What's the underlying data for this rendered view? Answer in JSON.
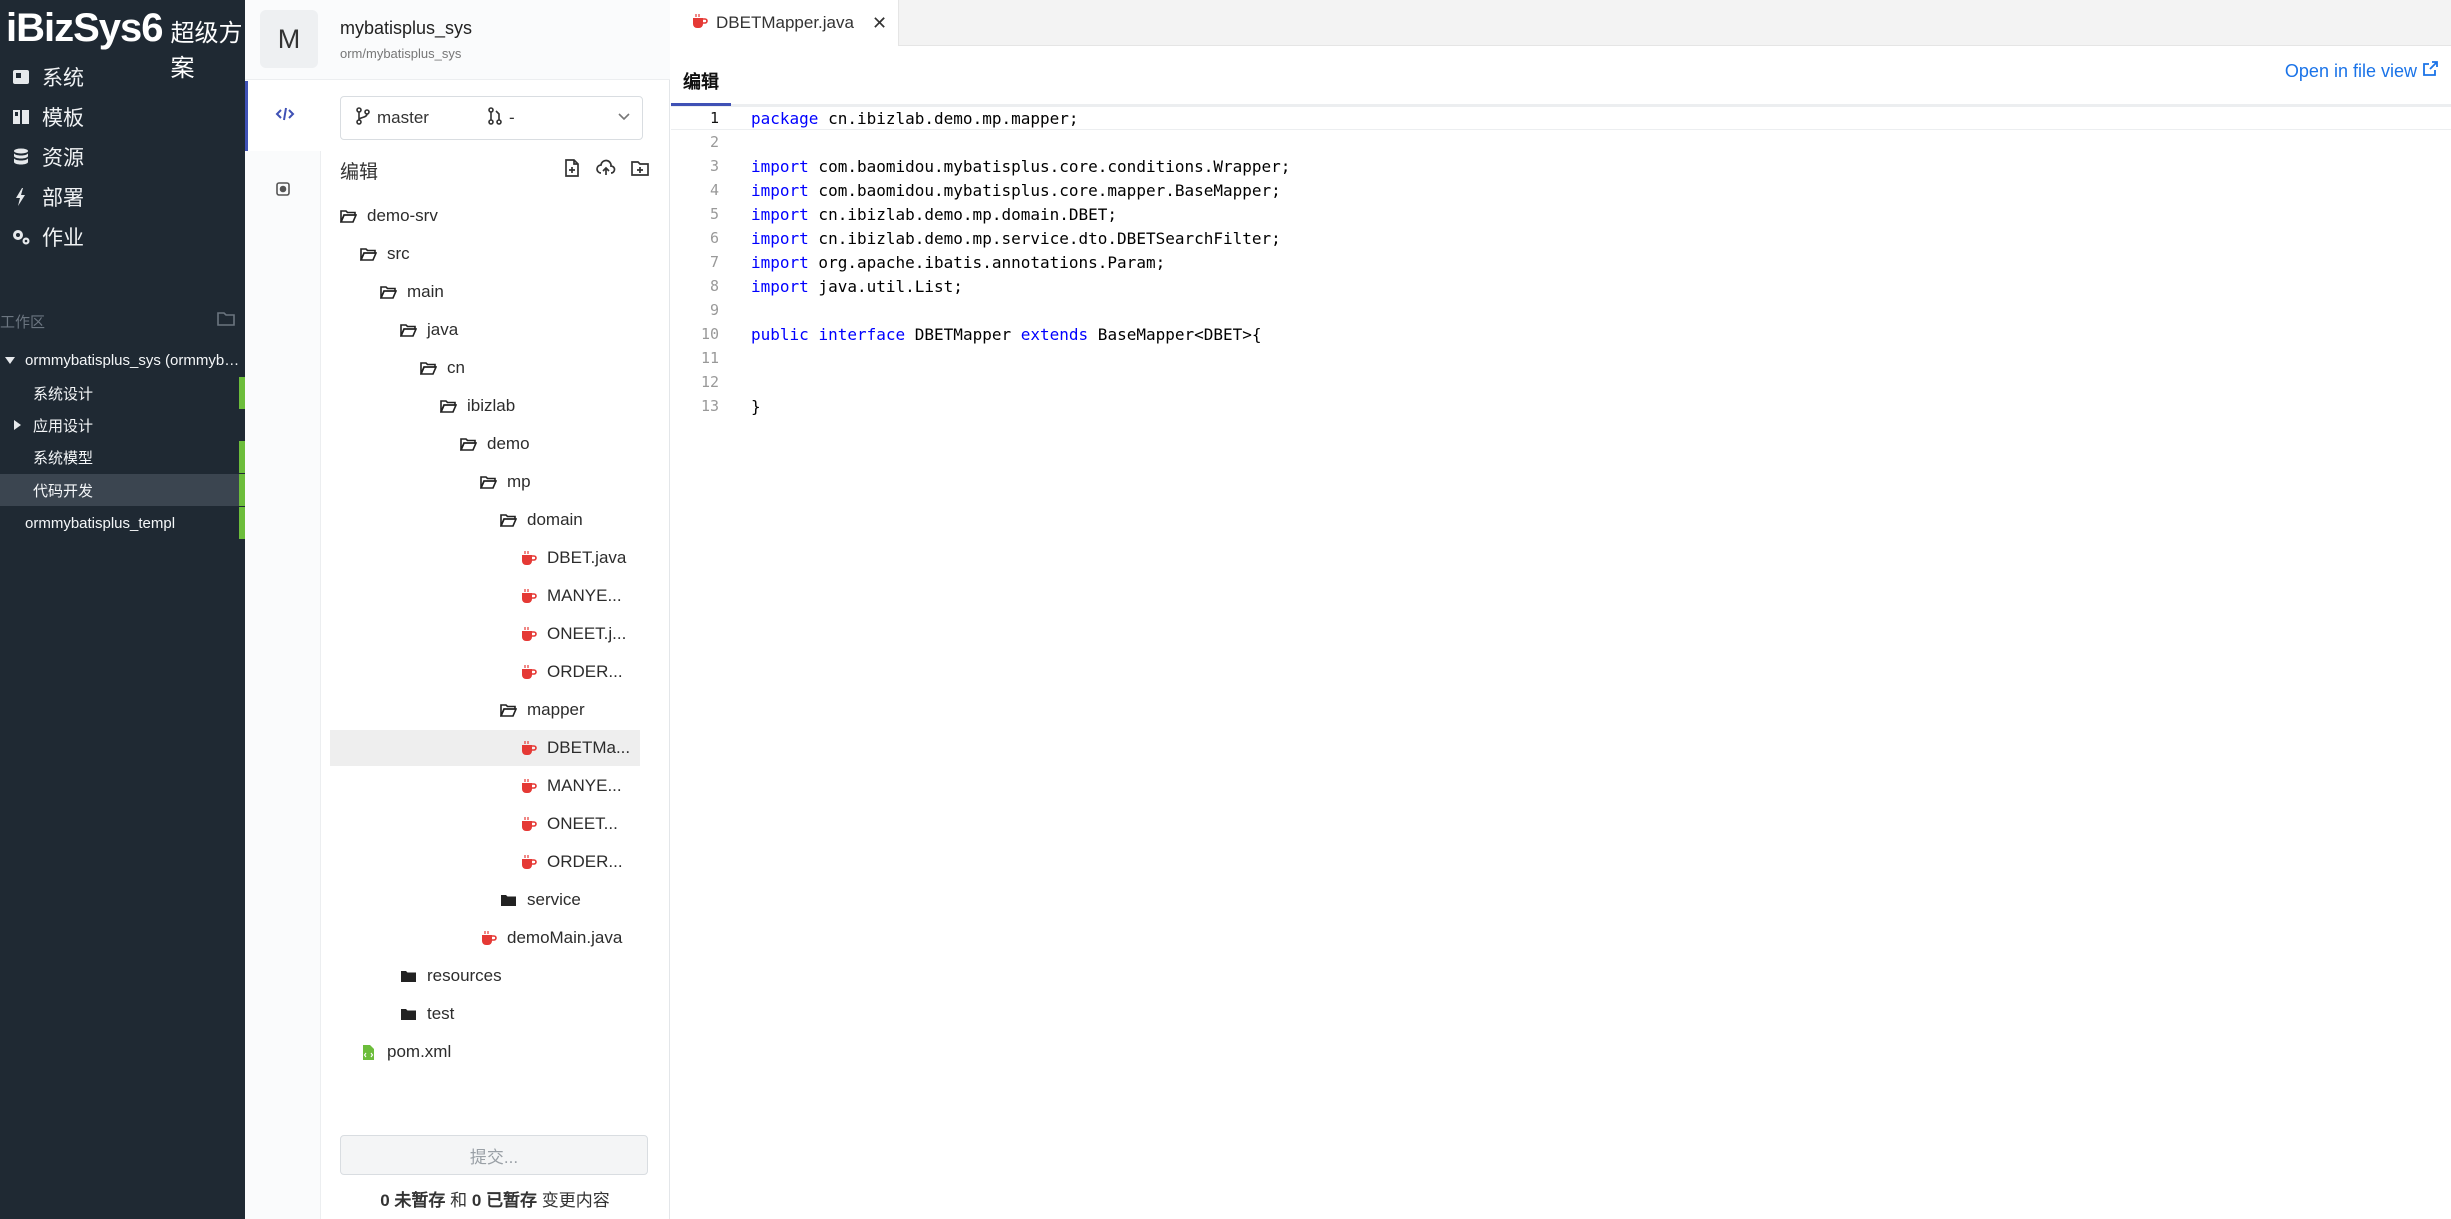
{
  "app": {
    "brand": "iBizSys6",
    "brand_sub": "超级方案"
  },
  "nav": [
    {
      "label": "系统",
      "icon": "dashboard-icon"
    },
    {
      "label": "模板",
      "icon": "book-icon"
    },
    {
      "label": "资源",
      "icon": "database-icon"
    },
    {
      "label": "部署",
      "icon": "bolt-icon"
    },
    {
      "label": "作业",
      "icon": "cogs-icon"
    }
  ],
  "workspace": {
    "heading": "工作区",
    "items": [
      {
        "label": "ormmybatisplus_sys (ormmyb…",
        "expanded": true
      },
      {
        "label": "系统设计"
      },
      {
        "label": "应用设计",
        "expanded": false
      },
      {
        "label": "系统模型"
      },
      {
        "label": "代码开发",
        "active": true
      },
      {
        "label": "ormmybatisplus_templ"
      }
    ]
  },
  "project": {
    "avatar": "M",
    "title": "mybatisplus_sys",
    "path": "orm/mybatisplus_sys",
    "branch": "master",
    "merge_request": "-"
  },
  "edit_panel": {
    "heading": "编辑"
  },
  "file_tree": [
    {
      "label": "demo-srv",
      "type": "folder-open",
      "depth": 0
    },
    {
      "label": "src",
      "type": "folder-open",
      "depth": 1
    },
    {
      "label": "main",
      "type": "folder-open",
      "depth": 2
    },
    {
      "label": "java",
      "type": "folder-open",
      "depth": 3
    },
    {
      "label": "cn",
      "type": "folder-open",
      "depth": 4
    },
    {
      "label": "ibizlab",
      "type": "folder-open",
      "depth": 5
    },
    {
      "label": "demo",
      "type": "folder-open",
      "depth": 6
    },
    {
      "label": "mp",
      "type": "folder-open",
      "depth": 7
    },
    {
      "label": "domain",
      "type": "folder-open",
      "depth": 8
    },
    {
      "label": "DBET.java",
      "type": "java",
      "depth": 9
    },
    {
      "label": "MANYE...",
      "type": "java",
      "depth": 9
    },
    {
      "label": "ONEET.j...",
      "type": "java",
      "depth": 9
    },
    {
      "label": "ORDER...",
      "type": "java",
      "depth": 9
    },
    {
      "label": "mapper",
      "type": "folder-open",
      "depth": 8
    },
    {
      "label": "DBETMa...",
      "type": "java",
      "depth": 9,
      "selected": true
    },
    {
      "label": "MANYE...",
      "type": "java",
      "depth": 9
    },
    {
      "label": "ONEET...",
      "type": "java",
      "depth": 9
    },
    {
      "label": "ORDER...",
      "type": "java",
      "depth": 9
    },
    {
      "label": "service",
      "type": "folder",
      "depth": 8
    },
    {
      "label": "demoMain.java",
      "type": "java",
      "depth": 7
    },
    {
      "label": "resources",
      "type": "folder",
      "depth": 3
    },
    {
      "label": "test",
      "type": "folder",
      "depth": 3
    },
    {
      "label": "pom.xml",
      "type": "xml",
      "depth": 1
    }
  ],
  "commit": {
    "button": "提交...",
    "unstaged_count": "0",
    "unstaged_label": "未暂存",
    "and": "和",
    "staged_count": "0",
    "staged_label": "已暂存",
    "changes": "变更内容"
  },
  "editor": {
    "tab_title": "DBETMapper.java",
    "mode_tab": "编辑",
    "open_in_file_view": "Open in file view",
    "lines": [
      [
        {
          "t": "package",
          "k": 1
        },
        {
          "t": " cn.ibizlab.demo.mp.mapper;"
        }
      ],
      [],
      [
        {
          "t": "import",
          "k": 1
        },
        {
          "t": " com.baomidou.mybatisplus.core.conditions.Wrapper;"
        }
      ],
      [
        {
          "t": "import",
          "k": 1
        },
        {
          "t": " com.baomidou.mybatisplus.core.mapper.BaseMapper;"
        }
      ],
      [
        {
          "t": "import",
          "k": 1
        },
        {
          "t": " cn.ibizlab.demo.mp.domain.DBET;"
        }
      ],
      [
        {
          "t": "import",
          "k": 1
        },
        {
          "t": " cn.ibizlab.demo.mp.service.dto.DBETSearchFilter;"
        }
      ],
      [
        {
          "t": "import",
          "k": 1
        },
        {
          "t": " org.apache.ibatis.annotations.Param;"
        }
      ],
      [
        {
          "t": "import",
          "k": 1
        },
        {
          "t": " java.util.List;"
        }
      ],
      [],
      [
        {
          "t": "public",
          "k": 1
        },
        {
          "t": " "
        },
        {
          "t": "interface",
          "k": 1
        },
        {
          "t": " DBETMapper "
        },
        {
          "t": "extends",
          "k": 1
        },
        {
          "t": " BaseMapper<DBET>{"
        }
      ],
      [],
      [],
      [
        {
          "t": "}"
        }
      ]
    ]
  },
  "colors": {
    "sidebar_bg": "#1f2933",
    "accent_green": "#6cbd3b",
    "active_tab": "#3f51b5",
    "java_icon": "#e53935",
    "xml_icon": "#6cbd3b",
    "link": "#1a73e8",
    "keyword": "#0000ff"
  }
}
